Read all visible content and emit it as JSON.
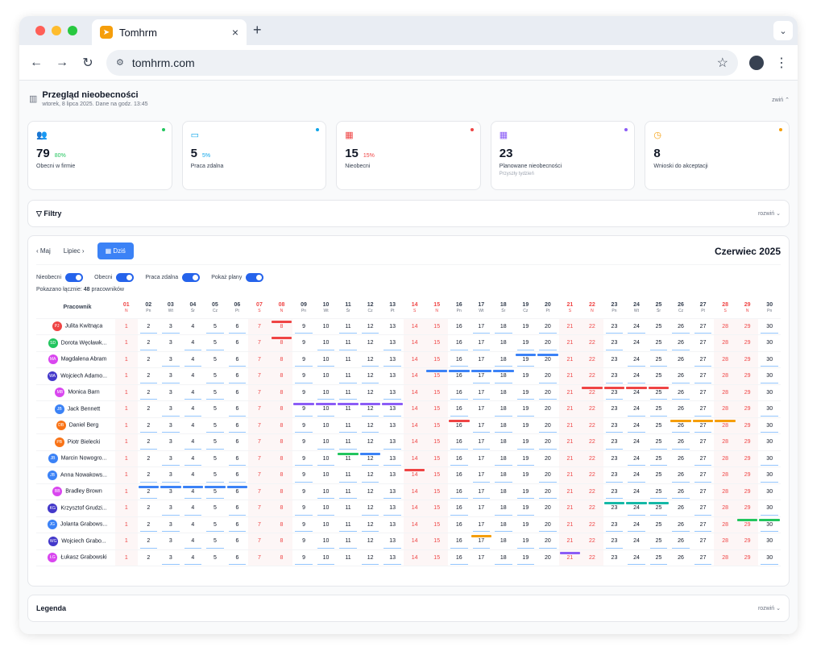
{
  "browser": {
    "tab_title": "Tomhrm",
    "url": "tomhrm.com",
    "new_tab": "+",
    "close": "×"
  },
  "header": {
    "title": "Przegląd nieobecności",
    "subtitle": "wtorek, 8 lipca 2025. Dane na godz. 13:45",
    "collapse_label": "zwiń ⌃"
  },
  "cards": [
    {
      "value": "79",
      "pct": "80%",
      "label": "Obecni w firmie",
      "sub": "",
      "color": "#22c55e",
      "icon": "👥"
    },
    {
      "value": "5",
      "pct": "5%",
      "label": "Praca zdalna",
      "sub": "",
      "color": "#0ea5e9",
      "icon": "▭"
    },
    {
      "value": "15",
      "pct": "15%",
      "label": "Nieobecni",
      "sub": "",
      "color": "#ef4444",
      "icon": "▦"
    },
    {
      "value": "23",
      "pct": "",
      "label": "Planowane nieobecności",
      "sub": "Przyszły tydzień",
      "color": "#8b5cf6",
      "icon": "▦"
    },
    {
      "value": "8",
      "pct": "",
      "label": "Wnioski do akceptacji",
      "sub": "",
      "color": "#f59e0b",
      "icon": "◷"
    }
  ],
  "filters": {
    "label": "▽ Filtry",
    "expand_label": "rozwiń ⌄"
  },
  "calendar": {
    "prev_label": "‹  Maj",
    "next_label": "Lipiec  ›",
    "today_label": "▦ Dziś",
    "month_title": "Czerwiec 2025",
    "toggles": [
      "Nieobecni",
      "Obecni",
      "Praca zdalna",
      "Pokaż plany"
    ],
    "shown_prefix": "Pokazano łącznie: ",
    "shown_count": "48",
    "shown_suffix": " pracowników",
    "employee_header": "Pracownik",
    "days": [
      {
        "n": "01",
        "d": "N",
        "we": true
      },
      {
        "n": "02",
        "d": "Pn",
        "we": false
      },
      {
        "n": "03",
        "d": "Wt",
        "we": false
      },
      {
        "n": "04",
        "d": "Śr",
        "we": false
      },
      {
        "n": "05",
        "d": "Cz",
        "we": false
      },
      {
        "n": "06",
        "d": "Pt",
        "we": false
      },
      {
        "n": "07",
        "d": "S",
        "we": true
      },
      {
        "n": "08",
        "d": "N",
        "we": true
      },
      {
        "n": "09",
        "d": "Pn",
        "we": false
      },
      {
        "n": "10",
        "d": "Wt",
        "we": false
      },
      {
        "n": "11",
        "d": "Śr",
        "we": false
      },
      {
        "n": "12",
        "d": "Cz",
        "we": false
      },
      {
        "n": "13",
        "d": "Pt",
        "we": false
      },
      {
        "n": "14",
        "d": "S",
        "we": true
      },
      {
        "n": "15",
        "d": "N",
        "we": true
      },
      {
        "n": "16",
        "d": "Pn",
        "we": false
      },
      {
        "n": "17",
        "d": "Wt",
        "we": false
      },
      {
        "n": "18",
        "d": "Śr",
        "we": false
      },
      {
        "n": "19",
        "d": "Cz",
        "we": false
      },
      {
        "n": "20",
        "d": "Pt",
        "we": false
      },
      {
        "n": "21",
        "d": "S",
        "we": true
      },
      {
        "n": "22",
        "d": "N",
        "we": true
      },
      {
        "n": "23",
        "d": "Pn",
        "we": false
      },
      {
        "n": "24",
        "d": "Wt",
        "we": false
      },
      {
        "n": "25",
        "d": "Śr",
        "we": false
      },
      {
        "n": "26",
        "d": "Cz",
        "we": false
      },
      {
        "n": "27",
        "d": "Pt",
        "we": false
      },
      {
        "n": "28",
        "d": "S",
        "we": true
      },
      {
        "n": "29",
        "d": "N",
        "we": true
      },
      {
        "n": "30",
        "d": "Pn",
        "we": false
      }
    ],
    "employees": [
      {
        "initials": "PJ",
        "name": "Julita Kwitnąca",
        "color": "#ef4444",
        "bars": {
          "8": "#ef4444"
        }
      },
      {
        "initials": "SD",
        "name": "Dorota Węcławk...",
        "color": "#22c55e",
        "bars": {
          "8": "#ef4444"
        }
      },
      {
        "initials": "MA",
        "name": "Magdalena Abram",
        "color": "#d946ef",
        "bars": {
          "19": "#3b82f6",
          "20": "#3b82f6"
        }
      },
      {
        "initials": "WA",
        "name": "Wojciech Adamo...",
        "color": "#4338ca",
        "bars": {
          "15": "#3b82f6",
          "16": "#3b82f6",
          "17": "#3b82f6",
          "18": "#3b82f6"
        }
      },
      {
        "initials": "MB",
        "name": "Monica Barn",
        "color": "#d946ef",
        "bars": {
          "22": "#ef4444",
          "23": "#ef4444",
          "24": "#ef4444",
          "25": "#ef4444"
        }
      },
      {
        "initials": "JB",
        "name": "Jack Bennett",
        "color": "#3b82f6",
        "bars": {
          "9": "#8b5cf6",
          "10": "#8b5cf6",
          "11": "#8b5cf6",
          "12": "#8b5cf6",
          "13": "#8b5cf6"
        }
      },
      {
        "initials": "DB",
        "name": "Daniel Berg",
        "color": "#f97316",
        "bars": {
          "16": "#ef4444",
          "26": "#f59e0b",
          "27": "#f59e0b",
          "28": "#f59e0b"
        }
      },
      {
        "initials": "PB",
        "name": "Piotr Bielecki",
        "color": "#f97316",
        "bars": {}
      },
      {
        "initials": "JB",
        "name": "Marcin Nowogro...",
        "color": "#3b82f6",
        "bars": {
          "11": "#22c55e",
          "12": "#3b82f6"
        }
      },
      {
        "initials": "JB",
        "name": "Anna Nowakows...",
        "color": "#3b82f6",
        "bars": {
          "14": "#ef4444"
        }
      },
      {
        "initials": "BB",
        "name": "Bradley Brown",
        "color": "#d946ef",
        "bars": {
          "2": "#3b82f6",
          "3": "#3b82f6",
          "4": "#3b82f6",
          "5": "#3b82f6",
          "6": "#3b82f6"
        }
      },
      {
        "initials": "KG",
        "name": "Krzysztof Grudzi...",
        "color": "#4338ca",
        "bars": {
          "23": "#14b8a6",
          "24": "#14b8a6",
          "25": "#14b8a6"
        }
      },
      {
        "initials": "JG",
        "name": "Jolanta Grabows...",
        "color": "#3b82f6",
        "bars": {
          "29": "#22c55e",
          "30": "#22c55e"
        }
      },
      {
        "initials": "WG",
        "name": "Wojciech Grabo...",
        "color": "#4338ca",
        "bars": {
          "17": "#f59e0b"
        }
      },
      {
        "initials": "ŁG",
        "name": "Łukasz Grabowski",
        "color": "#d946ef",
        "bars": {
          "21": "#8b5cf6"
        }
      }
    ]
  },
  "legend": {
    "label": "Legenda",
    "expand_label": "rozwiń ⌄"
  }
}
